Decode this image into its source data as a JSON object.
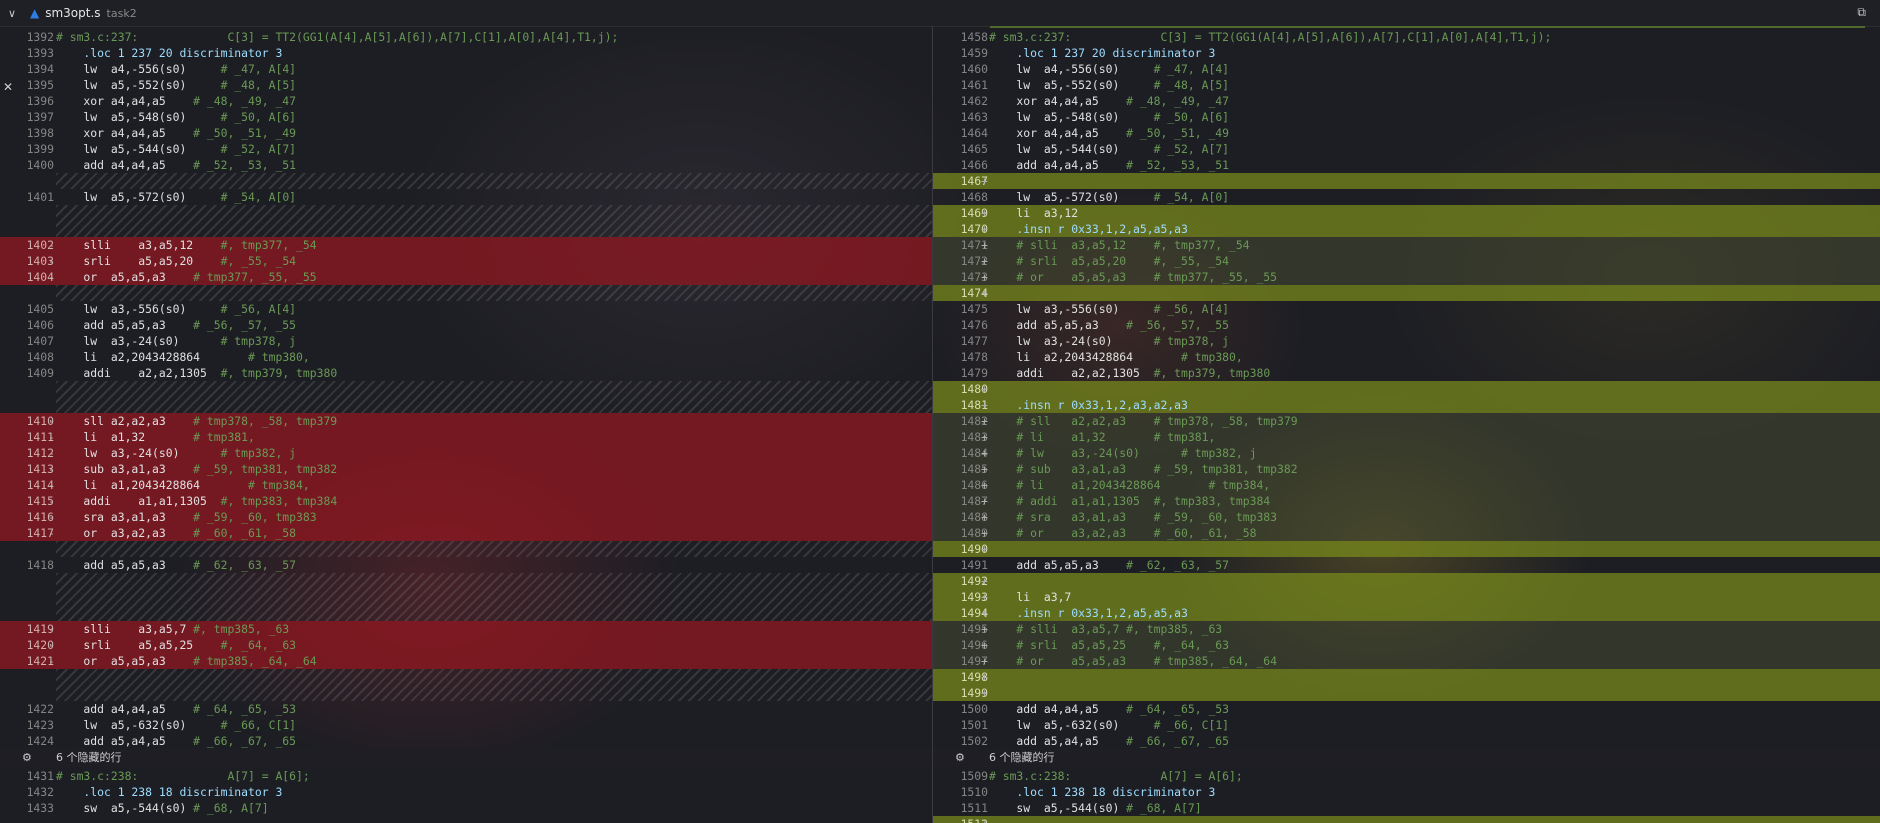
{
  "tab": {
    "file_name": "sm3opt.s",
    "group": "task2",
    "chevron": "v",
    "file_icon": "assembly-file-icon",
    "action_icon": "open-changes-icon"
  },
  "left_lines": [
    {
      "n": "1392",
      "s": "",
      "t": "# sm3.c:237:             C[3] = TT2(GG1(A[4],A[5],A[6]),A[7],C[1],A[0],A[4],T1,j);",
      "k": "c",
      "y": 0
    },
    {
      "n": "1393",
      "s": "",
      "t": "    .loc 1 237 20 discriminator 3",
      "k": "n",
      "y": 1
    },
    {
      "n": "1394",
      "s": "",
      "t": "    lw  a4,-556(s0)     # _47, A[4]",
      "k": "n",
      "y": 2
    },
    {
      "n": "1395",
      "s": "",
      "t": "    lw  a5,-552(s0)     # _48, A[5]",
      "k": "n",
      "y": 3
    },
    {
      "n": "1396",
      "s": "",
      "t": "    xor a4,a4,a5    # _48, _49, _47",
      "k": "n",
      "y": 4
    },
    {
      "n": "1397",
      "s": "",
      "t": "    lw  a5,-548(s0)     # _50, A[6]",
      "k": "n",
      "y": 5
    },
    {
      "n": "1398",
      "s": "",
      "t": "    xor a4,a4,a5    # _50, _51, _49",
      "k": "n",
      "y": 6
    },
    {
      "n": "1399",
      "s": "",
      "t": "    lw  a5,-544(s0)     # _52, A[7]",
      "k": "n",
      "y": 7
    },
    {
      "n": "1400",
      "s": "",
      "t": "    add a4,a4,a5    # _52, _53, _51",
      "k": "n",
      "y": 8
    },
    {
      "n": "1401",
      "s": "",
      "t": "    lw  a5,-572(s0)     # _54, A[0]",
      "k": "n",
      "y": 10
    },
    {
      "n": "1402",
      "s": "-",
      "t": "    slli    a3,a5,12    #, tmp377, _54",
      "k": "d",
      "y": 13
    },
    {
      "n": "1403",
      "s": "-",
      "t": "    srli    a5,a5,20    #, _55, _54",
      "k": "d",
      "y": 14
    },
    {
      "n": "1404",
      "s": "-",
      "t": "    or  a5,a5,a3    # tmp377, _55, _55",
      "k": "d",
      "y": 15
    },
    {
      "n": "1405",
      "s": "",
      "t": "    lw  a3,-556(s0)     # _56, A[4]",
      "k": "n",
      "y": 17
    },
    {
      "n": "1406",
      "s": "",
      "t": "    add a5,a5,a3    # _56, _57, _55",
      "k": "n",
      "y": 18
    },
    {
      "n": "1407",
      "s": "",
      "t": "    lw  a3,-24(s0)      # tmp378, j",
      "k": "n",
      "y": 19
    },
    {
      "n": "1408",
      "s": "",
      "t": "    li  a2,2043428864       # tmp380,",
      "k": "n",
      "y": 20
    },
    {
      "n": "1409",
      "s": "",
      "t": "    addi    a2,a2,1305  #, tmp379, tmp380",
      "k": "n",
      "y": 21
    },
    {
      "n": "1410",
      "s": "-",
      "t": "    sll a2,a2,a3    # tmp378, _58, tmp379",
      "k": "d",
      "y": 24
    },
    {
      "n": "1411",
      "s": "-",
      "t": "    li  a1,32       # tmp381,",
      "k": "d",
      "y": 25
    },
    {
      "n": "1412",
      "s": "-",
      "t": "    lw  a3,-24(s0)      # tmp382, j",
      "k": "d",
      "y": 26
    },
    {
      "n": "1413",
      "s": "-",
      "t": "    sub a3,a1,a3    # _59, tmp381, tmp382",
      "k": "d",
      "y": 27
    },
    {
      "n": "1414",
      "s": "-",
      "t": "    li  a1,2043428864       # tmp384,",
      "k": "d",
      "y": 28
    },
    {
      "n": "1415",
      "s": "-",
      "t": "    addi    a1,a1,1305  #, tmp383, tmp384",
      "k": "d",
      "y": 29
    },
    {
      "n": "1416",
      "s": "-",
      "t": "    sra a3,a1,a3    # _59, _60, tmp383",
      "k": "d",
      "y": 30
    },
    {
      "n": "1417",
      "s": "-",
      "t": "    or  a3,a2,a3    # _60, _61, _58",
      "k": "d",
      "y": 31
    },
    {
      "n": "1418",
      "s": "",
      "t": "    add a5,a5,a3    # _62, _63, _57",
      "k": "n",
      "y": 33
    },
    {
      "n": "1419",
      "s": "-",
      "t": "    slli    a3,a5,7 #, tmp385, _63",
      "k": "d",
      "y": 37
    },
    {
      "n": "1420",
      "s": "-",
      "t": "    srli    a5,a5,25    #, _64, _63",
      "k": "d",
      "y": 38
    },
    {
      "n": "1421",
      "s": "-",
      "t": "    or  a5,a5,a3    # tmp385, _64, _64",
      "k": "d",
      "y": 39
    },
    {
      "n": "1422",
      "s": "",
      "t": "    add a4,a4,a5    # _64, _65, _53",
      "k": "n",
      "y": 42
    },
    {
      "n": "1423",
      "s": "",
      "t": "    lw  a5,-632(s0)     # _66, C[1]",
      "k": "n",
      "y": 43
    },
    {
      "n": "1424",
      "s": "",
      "t": "    add a5,a4,a5    # _66, _67, _65",
      "k": "n",
      "y": 44
    },
    {
      "n": "1431",
      "s": "",
      "t": "# sm3.c:238:             A[7] = A[6];",
      "k": "c",
      "y": 46.2
    },
    {
      "n": "1432",
      "s": "",
      "t": "    .loc 1 238 18 discriminator 3",
      "k": "n",
      "y": 47.2
    },
    {
      "n": "1433",
      "s": "",
      "t": "    sw  a5,-544(s0) # _68, A[7]",
      "k": "n",
      "y": 48.2
    }
  ],
  "right_lines": [
    {
      "n": "1458",
      "s": "",
      "t": "# sm3.c:237:             C[3] = TT2(GG1(A[4],A[5],A[6]),A[7],C[1],A[0],A[4],T1,j);",
      "k": "c",
      "y": 0
    },
    {
      "n": "1459",
      "s": "",
      "t": "    .loc 1 237 20 discriminator 3",
      "k": "n",
      "y": 1
    },
    {
      "n": "1460",
      "s": "",
      "t": "    lw  a4,-556(s0)     # _47, A[4]",
      "k": "n",
      "y": 2
    },
    {
      "n": "1461",
      "s": "",
      "t": "    lw  a5,-552(s0)     # _48, A[5]",
      "k": "n",
      "y": 3
    },
    {
      "n": "1462",
      "s": "",
      "t": "    xor a4,a4,a5    # _48, _49, _47",
      "k": "n",
      "y": 4
    },
    {
      "n": "1463",
      "s": "",
      "t": "    lw  a5,-548(s0)     # _50, A[6]",
      "k": "n",
      "y": 5
    },
    {
      "n": "1464",
      "s": "",
      "t": "    xor a4,a4,a5    # _50, _51, _49",
      "k": "n",
      "y": 6
    },
    {
      "n": "1465",
      "s": "",
      "t": "    lw  a5,-544(s0)     # _52, A[7]",
      "k": "n",
      "y": 7
    },
    {
      "n": "1466",
      "s": "",
      "t": "    add a4,a4,a5    # _52, _53, _51",
      "k": "n",
      "y": 8
    },
    {
      "n": "1467",
      "s": "+",
      "t": "",
      "k": "i",
      "y": 9
    },
    {
      "n": "1468",
      "s": "",
      "t": "    lw  a5,-572(s0)     # _54, A[0]",
      "k": "n",
      "y": 10
    },
    {
      "n": "1469",
      "s": "+",
      "t": "    li  a3,12",
      "k": "i",
      "y": 11
    },
    {
      "n": "1470",
      "s": "+",
      "t": "    .insn r 0x33,1,2,a5,a5,a3",
      "k": "i",
      "y": 12
    },
    {
      "n": "1471",
      "s": "+",
      "t": "    # slli  a3,a5,12    #, tmp377, _54",
      "k": "m",
      "y": 13
    },
    {
      "n": "1472",
      "s": "+",
      "t": "    # srli  a5,a5,20    #, _55, _54",
      "k": "m",
      "y": 14
    },
    {
      "n": "1473",
      "s": "+",
      "t": "    # or    a5,a5,a3    # tmp377, _55, _55",
      "k": "m",
      "y": 15
    },
    {
      "n": "1474",
      "s": "+",
      "t": "",
      "k": "i",
      "y": 16
    },
    {
      "n": "1475",
      "s": "",
      "t": "    lw  a3,-556(s0)     # _56, A[4]",
      "k": "n",
      "y": 17
    },
    {
      "n": "1476",
      "s": "",
      "t": "    add a5,a5,a3    # _56, _57, _55",
      "k": "n",
      "y": 18
    },
    {
      "n": "1477",
      "s": "",
      "t": "    lw  a3,-24(s0)      # tmp378, j",
      "k": "n",
      "y": 19
    },
    {
      "n": "1478",
      "s": "",
      "t": "    li  a2,2043428864       # tmp380,",
      "k": "n",
      "y": 20
    },
    {
      "n": "1479",
      "s": "",
      "t": "    addi    a2,a2,1305  #, tmp379, tmp380",
      "k": "n",
      "y": 21
    },
    {
      "n": "1480",
      "s": "+",
      "t": "",
      "k": "i",
      "y": 22
    },
    {
      "n": "1481",
      "s": "+",
      "t": "    .insn r 0x33,1,2,a3,a2,a3",
      "k": "i",
      "y": 23
    },
    {
      "n": "1482",
      "s": "+",
      "t": "    # sll   a2,a2,a3    # tmp378, _58, tmp379",
      "k": "m",
      "y": 24
    },
    {
      "n": "1483",
      "s": "+",
      "t": "    # li    a1,32       # tmp381,",
      "k": "m",
      "y": 25
    },
    {
      "n": "1484",
      "s": "+",
      "t": "    # lw    a3,-24(s0)      # tmp382, j",
      "k": "m",
      "y": 26
    },
    {
      "n": "1485",
      "s": "+",
      "t": "    # sub   a3,a1,a3    # _59, tmp381, tmp382",
      "k": "m",
      "y": 27
    },
    {
      "n": "1486",
      "s": "+",
      "t": "    # li    a1,2043428864       # tmp384,",
      "k": "m",
      "y": 28
    },
    {
      "n": "1487",
      "s": "+",
      "t": "    # addi  a1,a1,1305  #, tmp383, tmp384",
      "k": "m",
      "y": 29
    },
    {
      "n": "1488",
      "s": "+",
      "t": "    # sra   a3,a1,a3    # _59, _60, tmp383",
      "k": "m",
      "y": 30
    },
    {
      "n": "1489",
      "s": "+",
      "t": "    # or    a3,a2,a3    # _60, _61, _58",
      "k": "m",
      "y": 31
    },
    {
      "n": "1490",
      "s": "+",
      "t": "",
      "k": "i",
      "y": 32
    },
    {
      "n": "1491",
      "s": "",
      "t": "    add a5,a5,a3    # _62, _63, _57",
      "k": "n",
      "y": 33
    },
    {
      "n": "1492",
      "s": "+",
      "t": "",
      "k": "i",
      "y": 34
    },
    {
      "n": "1493",
      "s": "+",
      "t": "    li  a3,7",
      "k": "i",
      "y": 35
    },
    {
      "n": "1494",
      "s": "+",
      "t": "    .insn r 0x33,1,2,a5,a5,a3",
      "k": "i",
      "y": 36
    },
    {
      "n": "1495",
      "s": "+",
      "t": "    # slli  a3,a5,7 #, tmp385, _63",
      "k": "m",
      "y": 37
    },
    {
      "n": "1496",
      "s": "+",
      "t": "    # srli  a5,a5,25    #, _64, _63",
      "k": "m",
      "y": 38
    },
    {
      "n": "1497",
      "s": "+",
      "t": "    # or    a5,a5,a3    # tmp385, _64, _64",
      "k": "m",
      "y": 39
    },
    {
      "n": "1498",
      "s": "+",
      "t": "",
      "k": "i",
      "y": 40
    },
    {
      "n": "1499",
      "s": "+",
      "t": "",
      "k": "i",
      "y": 41
    },
    {
      "n": "1500",
      "s": "",
      "t": "    add a4,a4,a5    # _64, _65, _53",
      "k": "n",
      "y": 42
    },
    {
      "n": "1501",
      "s": "",
      "t": "    lw  a5,-632(s0)     # _66, C[1]",
      "k": "n",
      "y": 43
    },
    {
      "n": "1502",
      "s": "",
      "t": "    add a5,a4,a5    # _66, _67, _65",
      "k": "n",
      "y": 44
    },
    {
      "n": "1509",
      "s": "",
      "t": "# sm3.c:238:             A[7] = A[6];",
      "k": "c",
      "y": 46.2
    },
    {
      "n": "1510",
      "s": "",
      "t": "    .loc 1 238 18 discriminator 3",
      "k": "n",
      "y": 47.2
    },
    {
      "n": "1511",
      "s": "",
      "t": "    sw  a5,-544(s0) # _68, A[7]",
      "k": "n",
      "y": 48.2
    },
    {
      "n": "1512",
      "s": "+",
      "t": "",
      "k": "i",
      "y": 49.2
    }
  ],
  "left_hatch": [
    [
      9,
      1
    ],
    [
      11,
      2
    ],
    [
      16,
      1
    ],
    [
      22,
      2
    ],
    [
      32,
      1
    ],
    [
      34,
      3
    ],
    [
      40,
      2
    ]
  ],
  "collapsed": {
    "label": "6 个隐藏的行",
    "icon": "unfold-icon",
    "y": 45
  },
  "side_marker": "close-icon",
  "colors": {
    "deleted": "#96161f",
    "inserted": "#7a8c1a"
  }
}
